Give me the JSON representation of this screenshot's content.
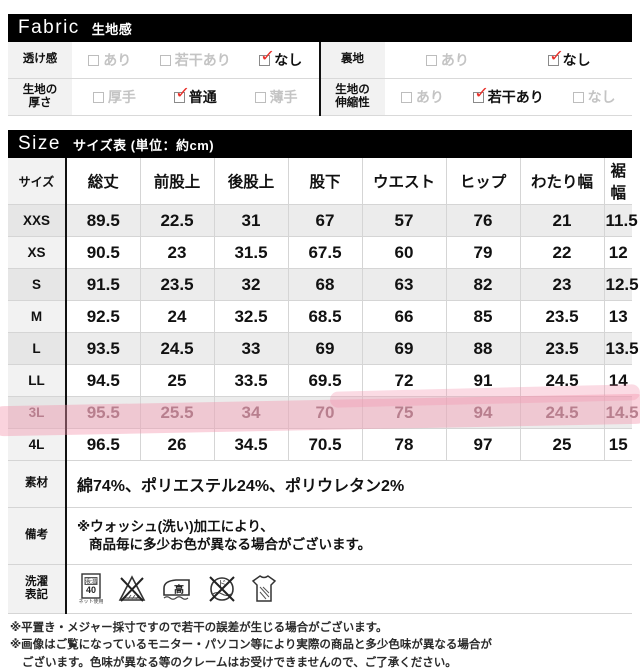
{
  "fabric": {
    "title_latin": "Fabric",
    "title_jp": "生地感",
    "rows": [
      {
        "label": "透け感",
        "options": [
          {
            "text": "あり",
            "checked": false
          },
          {
            "text": "若干あり",
            "checked": false
          },
          {
            "text": "なし",
            "checked": true
          }
        ],
        "label2": "裏地",
        "options2": [
          {
            "text": "あり",
            "checked": false
          },
          {
            "text": "なし",
            "checked": true
          }
        ]
      },
      {
        "label": "生地の\n厚さ",
        "label_line1": "生地の",
        "label_line2": "厚さ",
        "options": [
          {
            "text": "厚手",
            "checked": false
          },
          {
            "text": "普通",
            "checked": true
          },
          {
            "text": "薄手",
            "checked": false
          }
        ],
        "label2_line1": "生地の",
        "label2_line2": "伸縮性",
        "options2": [
          {
            "text": "あり",
            "checked": false
          },
          {
            "text": "若干あり",
            "checked": true
          },
          {
            "text": "なし",
            "checked": false
          }
        ]
      }
    ]
  },
  "size": {
    "title_latin": "Size",
    "title_jp": "サイズ表 (単位：約cm)",
    "columns": [
      "サイズ",
      "総丈",
      "前股上",
      "後股上",
      "股下",
      "ウエスト",
      "ヒップ",
      "わたり幅",
      "裾幅"
    ],
    "rows": [
      {
        "size": "XXS",
        "values": [
          "89.5",
          "22.5",
          "31",
          "67",
          "57",
          "76",
          "21",
          "11.5"
        ],
        "highlighted": false
      },
      {
        "size": "XS",
        "values": [
          "90.5",
          "23",
          "31.5",
          "67.5",
          "60",
          "79",
          "22",
          "12"
        ],
        "highlighted": false
      },
      {
        "size": "S",
        "values": [
          "91.5",
          "23.5",
          "32",
          "68",
          "63",
          "82",
          "23",
          "12.5"
        ],
        "highlighted": false
      },
      {
        "size": "M",
        "values": [
          "92.5",
          "24",
          "32.5",
          "68.5",
          "66",
          "85",
          "23.5",
          "13"
        ],
        "highlighted": false
      },
      {
        "size": "L",
        "values": [
          "93.5",
          "24.5",
          "33",
          "69",
          "69",
          "88",
          "23.5",
          "13.5"
        ],
        "highlighted": false
      },
      {
        "size": "LL",
        "values": [
          "94.5",
          "25",
          "33.5",
          "69.5",
          "72",
          "91",
          "24.5",
          "14"
        ],
        "highlighted": false
      },
      {
        "size": "3L",
        "values": [
          "95.5",
          "25.5",
          "34",
          "70",
          "75",
          "94",
          "24.5",
          "14.5"
        ],
        "highlighted": true
      },
      {
        "size": "4L",
        "values": [
          "96.5",
          "26",
          "34.5",
          "70.5",
          "78",
          "97",
          "25",
          "15"
        ],
        "highlighted": false
      }
    ],
    "highlight_color": "#f4"
  },
  "info": {
    "material_label": "素材",
    "material_value": "綿74%、ポリエステル24%、ポリウレタン2%",
    "note_label": "備考",
    "note_line1": "※ウォッシュ(洗い)加工により、",
    "note_line2": "商品毎に多少お色が異なる場合がございます。",
    "care_label_line1": "洗濯",
    "care_label_line2": "表記",
    "care_icons": [
      {
        "name": "machine-wash-40-net-icon",
        "text": "40"
      },
      {
        "name": "no-bleach-icon",
        "text": ""
      },
      {
        "name": "iron-high-icon",
        "text": "高"
      },
      {
        "name": "no-dryclean-icon",
        "text": ""
      },
      {
        "name": "drip-dry-shade-icon",
        "text": ""
      }
    ]
  },
  "footer": {
    "line1": "※平置き・メジャー採寸ですので若干の誤差が生じる場合がございます。",
    "line2": "※画像はご覧になっているモニター・パソコン等により実際の商品と多少色味が異なる場合が",
    "line3": "ございます。色味が異なる等のクレームはお受けできませんので、ご了承ください。"
  }
}
